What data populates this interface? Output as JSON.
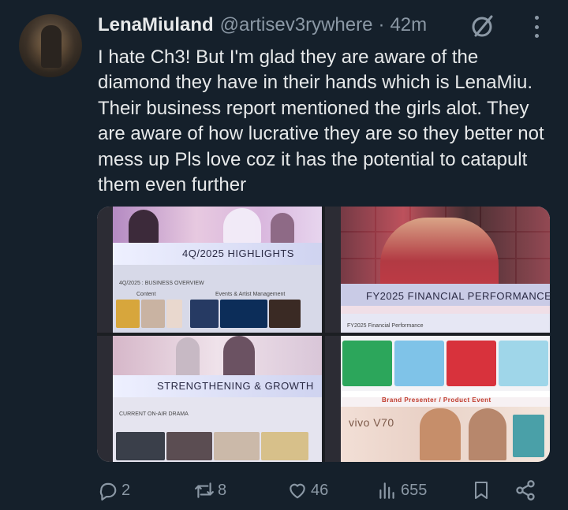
{
  "tweet": {
    "author_name": "LenaMiuland",
    "author_handle": "@artisev3rywhere",
    "separator": "·",
    "time_ago": "42m",
    "text": "I hate Ch3! But I'm glad they are aware of the diamond they have in their hands which is LenaMiu. Their business report mentioned the girls alot. They are aware of how lucrative they are so they better not mess up Pls love coz it has the potential to catapult them even further"
  },
  "media": [
    {
      "caption": "4Q/2025 HIGHLIGHTS",
      "sub_title": "4Q/2025 : BUSINESS OVERVIEW",
      "labels": [
        "Content",
        "Events & Artist Management"
      ]
    },
    {
      "caption": "FY2025 FINANCIAL PERFORMANCE",
      "sub_title": "FY2025 Financial Performance"
    },
    {
      "caption": "STRENGTHENING & GROWTH",
      "sub_title": "CURRENT ON-AIR DRAMA"
    },
    {
      "caption": "Brand Presenter / Product Event",
      "product_text": "vivo V70"
    }
  ],
  "actions": {
    "replies": "2",
    "reposts": "8",
    "likes": "46",
    "views": "655"
  },
  "colors": {
    "background": "#15202b",
    "text_primary": "#e7e9ea",
    "text_secondary": "#8b98a5"
  },
  "icons": [
    "grok-icon",
    "more-icon",
    "reply-icon",
    "repost-icon",
    "like-icon",
    "views-icon",
    "bookmark-icon",
    "share-icon"
  ]
}
